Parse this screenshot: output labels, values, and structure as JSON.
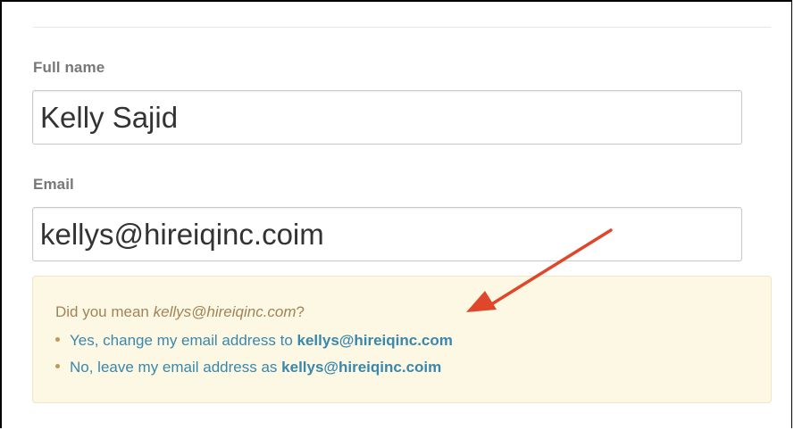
{
  "form": {
    "full_name_label": "Full name",
    "full_name_value": "Kelly Sajid",
    "email_label": "Email",
    "email_value": "kellys@hireiqinc.coim"
  },
  "suggestion": {
    "question_prefix": "Did you mean ",
    "question_suggested": "kellys@hireiqinc.com",
    "question_suffix": "?",
    "yes_prefix": "Yes, change my email address to ",
    "yes_email": "kellys@hireiqinc.com",
    "no_prefix": "No, leave my email address as ",
    "no_email": "kellys@hireiqinc.coim"
  },
  "colors": {
    "label": "#787878",
    "suggestion_bg": "#fcf8e3",
    "link": "#3a87ad",
    "annotation_arrow": "#e0462a"
  },
  "annotation": {
    "icon": "red-arrow-icon"
  }
}
